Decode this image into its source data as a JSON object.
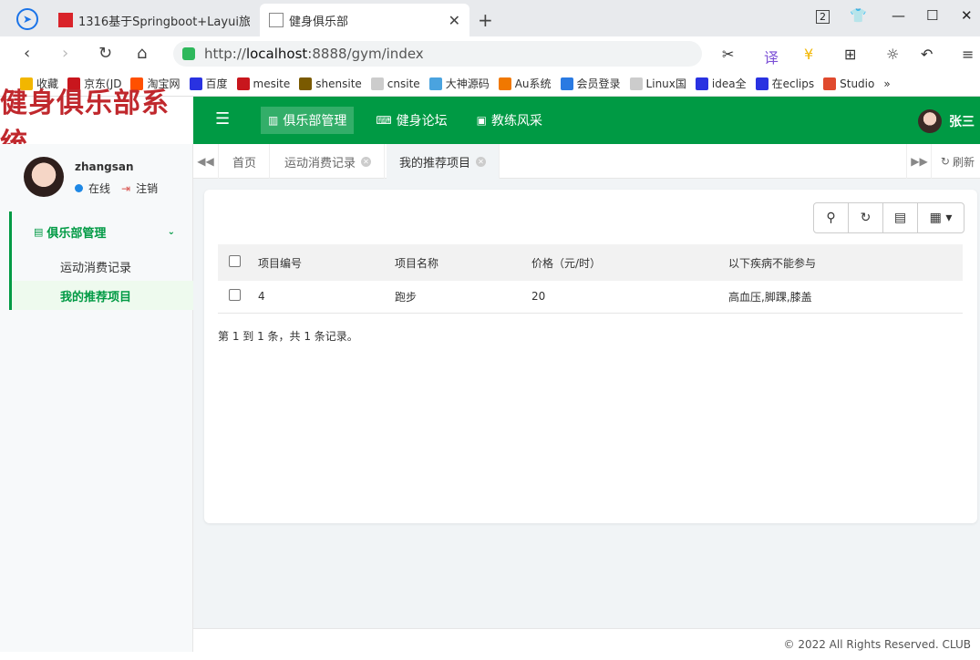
{
  "browser": {
    "tabs": [
      {
        "title": "1316基于Springboot+Layui旅",
        "favicon_color": "#d9232a"
      },
      {
        "title": "健身俱乐部",
        "favicon_color": "#888888"
      }
    ],
    "tab_count_badge": "2",
    "url_scheme": "http://",
    "url_host": "localhost",
    "url_rest": ":8888/gym/index",
    "bookmarks": [
      {
        "label": "收藏",
        "color": "#f2b600"
      },
      {
        "label": "京东(JD",
        "color": "#c8161d"
      },
      {
        "label": "淘宝网",
        "color": "#ff5000"
      },
      {
        "label": "百度",
        "color": "#2932e1"
      },
      {
        "label": "mesite",
        "color": "#c8161d"
      },
      {
        "label": "shensite",
        "color": "#7a5a00"
      },
      {
        "label": "cnsite",
        "color": "#cccccc"
      },
      {
        "label": "大神源码",
        "color": "#4aa3df"
      },
      {
        "label": "Au系统",
        "color": "#f07800"
      },
      {
        "label": "会员登录",
        "color": "#2a7ae2"
      },
      {
        "label": "Linux国",
        "color": "#cccccc"
      },
      {
        "label": "idea全",
        "color": "#2932e1"
      },
      {
        "label": "在eclips",
        "color": "#2932e1"
      },
      {
        "label": "Studio",
        "color": "#e04a2e"
      }
    ],
    "bookmarks_more": "»"
  },
  "app": {
    "logo": "健身俱乐部系统",
    "accent": "#009a44",
    "topnav": [
      {
        "label": "俱乐部管理",
        "icon": "bar-chart-icon",
        "glyph": "▥",
        "active": true
      },
      {
        "label": "健身论坛",
        "icon": "keyboard-icon",
        "glyph": "⌨",
        "active": false
      },
      {
        "label": "教练风采",
        "icon": "picture-icon",
        "glyph": "▣",
        "active": false
      }
    ],
    "top_user": "张三",
    "sidebar": {
      "username": "zhangsan",
      "status": "在线",
      "logout": "注销",
      "group": "俱乐部管理",
      "items": [
        {
          "label": "运动消费记录",
          "active": false
        },
        {
          "label": "我的推荐项目",
          "active": true
        }
      ]
    },
    "tabs": [
      {
        "label": "首页",
        "closable": false,
        "active": false
      },
      {
        "label": "运动消费记录",
        "closable": true,
        "active": false
      },
      {
        "label": "我的推荐项目",
        "closable": true,
        "active": true
      }
    ],
    "refresh_label": "刷新",
    "table": {
      "columns": [
        "项目编号",
        "项目名称",
        "价格（元/时）",
        "以下疾病不能参与"
      ],
      "rows": [
        [
          "4",
          "跑步",
          "20",
          "高血压,脚踝,膝盖"
        ]
      ]
    },
    "pager": "第 1 到 1 条，共 1 条记录。",
    "footer": "© 2022 All Rights Reserved. CLUB"
  }
}
